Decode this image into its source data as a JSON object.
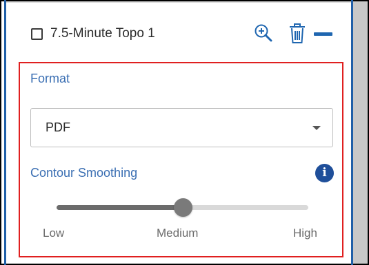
{
  "layer": {
    "title": "7.5-Minute Topo 1",
    "checked": false,
    "icons": {
      "zoom": "zoom-in-icon",
      "delete": "trash-icon",
      "collapse": "minus-icon",
      "info": "info-icon"
    }
  },
  "options": {
    "format_label": "Format",
    "format_value": "PDF",
    "contour_label": "Contour Smoothing",
    "info_glyph": "i",
    "slider": {
      "labels": [
        "Low",
        "Medium",
        "High"
      ],
      "value_fraction": 0.5
    }
  },
  "colors": {
    "accent": "#1f66b0",
    "label_blue": "#3b6fb3",
    "highlight_border": "#e02020"
  }
}
